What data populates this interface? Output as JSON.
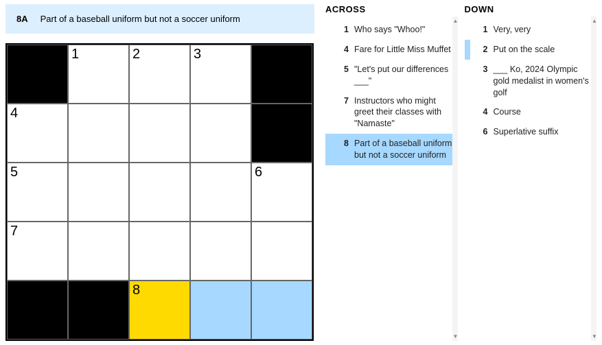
{
  "current_clue": {
    "label": "8A",
    "text": "Part of a baseball uniform but not a soccer uniform"
  },
  "grid_size": 5,
  "grid": [
    [
      {
        "black": true
      },
      {
        "num": "1"
      },
      {
        "num": "2"
      },
      {
        "num": "3"
      },
      {
        "black": true
      }
    ],
    [
      {
        "num": "4"
      },
      {},
      {},
      {},
      {
        "black": true
      }
    ],
    [
      {
        "num": "5"
      },
      {},
      {},
      {},
      {
        "num": "6"
      }
    ],
    [
      {
        "num": "7"
      },
      {},
      {},
      {},
      {}
    ],
    [
      {
        "black": true
      },
      {
        "black": true
      },
      {
        "num": "8",
        "state": "yellow"
      },
      {
        "state": "blue"
      },
      {
        "state": "blue"
      }
    ]
  ],
  "across": {
    "title": "ACROSS",
    "clues": [
      {
        "num": "1",
        "text": "Who says \"Whoo!\""
      },
      {
        "num": "4",
        "text": "Fare for Little Miss Muffet"
      },
      {
        "num": "5",
        "text": "\"Let's put our differences ___\""
      },
      {
        "num": "7",
        "text": "Instructors who might greet their classes with \"Namaste\""
      },
      {
        "num": "8",
        "text": "Part of a baseball uniform but not a soccer uniform",
        "selected": true
      }
    ]
  },
  "down": {
    "title": "DOWN",
    "clues": [
      {
        "num": "1",
        "text": "Very, very"
      },
      {
        "num": "2",
        "text": "Put on the scale",
        "related": true
      },
      {
        "num": "3",
        "text": "___ Ko, 2024 Olympic gold medalist in women's golf"
      },
      {
        "num": "4",
        "text": "Course"
      },
      {
        "num": "6",
        "text": "Superlative suffix"
      }
    ]
  }
}
